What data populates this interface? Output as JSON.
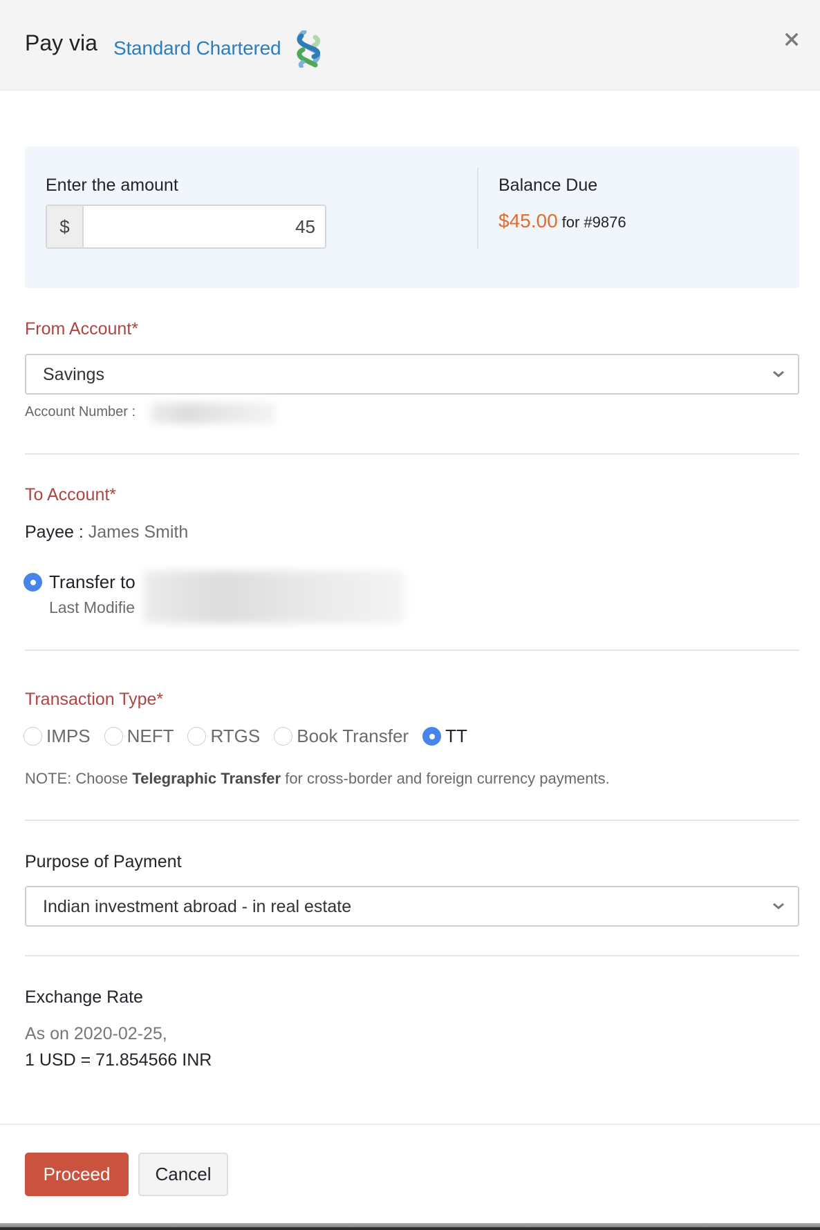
{
  "header": {
    "title": "Pay via",
    "brand": "Standard Chartered",
    "logo_icon": "standard-chartered-logo",
    "close_icon": "close-icon"
  },
  "amount": {
    "label": "Enter the amount",
    "currency_symbol": "$",
    "value": "45",
    "balance_label": "Balance Due",
    "balance_amount": "$45.00",
    "balance_for": "for #9876"
  },
  "from_account": {
    "label": "From Account*",
    "selected": "Savings",
    "account_number_label": "Account Number :"
  },
  "to_account": {
    "label": "To Account*",
    "payee_label": "Payee :",
    "payee_name": "James Smith",
    "transfer_label": "Transfer to",
    "last_modified_label": "Last Modifie"
  },
  "transaction_type": {
    "label": "Transaction Type*",
    "options": [
      {
        "label": "IMPS",
        "selected": false
      },
      {
        "label": "NEFT",
        "selected": false
      },
      {
        "label": "RTGS",
        "selected": false
      },
      {
        "label": "Book Transfer",
        "selected": false
      },
      {
        "label": "TT",
        "selected": true
      }
    ],
    "note_prefix": "NOTE: Choose",
    "note_bold": "Telegraphic Transfer",
    "note_suffix": "for cross-border and foreign currency payments."
  },
  "purpose": {
    "label": "Purpose of Payment",
    "selected": "Indian investment abroad - in real estate"
  },
  "exchange_rate": {
    "label": "Exchange Rate",
    "date_text": "As on 2020-02-25,",
    "rate_text": "1 USD = 71.854566 INR"
  },
  "footer": {
    "proceed_label": "Proceed",
    "cancel_label": "Cancel"
  },
  "colors": {
    "brand_blue": "#2e7dbc",
    "required_red": "#ae4542",
    "balance_orange": "#e36b2c",
    "primary_button": "#c9533e",
    "radio_selected": "#4786e8"
  }
}
